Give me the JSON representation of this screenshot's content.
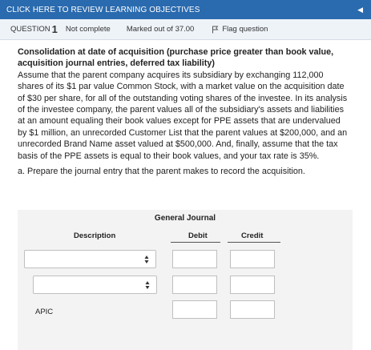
{
  "topbar": {
    "title": "CLICK HERE TO REVIEW LEARNING OBJECTIVES",
    "toggle_icon": "triangle-left-icon"
  },
  "question": {
    "label": "QUESTION",
    "number": "1",
    "status": "Not complete",
    "marks": "Marked out of 37.00",
    "flag_label": "Flag question",
    "flag_icon": "flag-icon"
  },
  "content": {
    "heading": "Consolidation at date of acquisition (purchase price greater than book value, acquisition journal entries, deferred tax liability)",
    "body": "Assume that the parent company acquires its subsidiary by exchanging 112,000 shares of its $1 par value Common Stock, with a market value on the acquisition date of $30 per share, for all of the outstanding voting shares of the investee. In its analysis of the investee company, the parent values all of the subsidiary's assets and liabilities at an amount equaling their book values except for PPE assets that are undervalued by $1 million, an unrecorded Customer List that the parent values at $200,000, and an unrecorded Brand Name asset valued at $500,000. And, finally, assume that the tax basis of the PPE assets is equal to their book values, and your tax rate is 35%.",
    "task": "a. Prepare the journal entry that the parent makes to record the acquisition."
  },
  "journal": {
    "title": "General Journal",
    "col_description": "Description",
    "col_debit": "Debit",
    "col_credit": "Credit",
    "rows": [
      {
        "description": "",
        "debit": "",
        "credit": ""
      },
      {
        "description": "",
        "debit": "",
        "credit": ""
      },
      {
        "description": "APIC",
        "debit": "",
        "credit": ""
      }
    ]
  }
}
